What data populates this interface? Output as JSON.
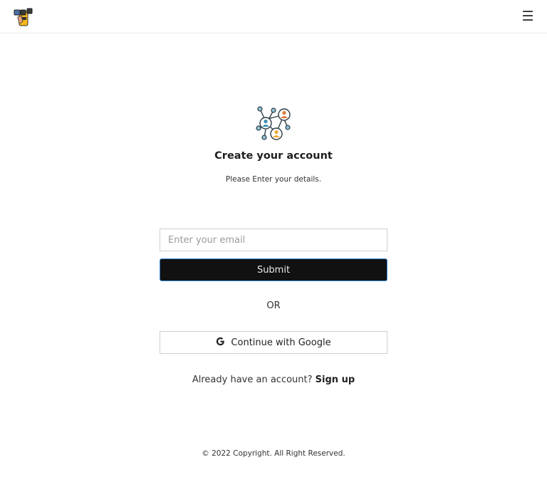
{
  "header": {
    "logo_icon": "app-logo-icon",
    "menu_icon": "hamburger-menu-icon",
    "menu_glyph": "☰"
  },
  "hero": {
    "icon": "network-people-icon",
    "title": "Create your account",
    "subtitle": "Please Enter your details."
  },
  "form": {
    "email_placeholder": "Enter your email",
    "email_value": "",
    "submit_label": "Submit"
  },
  "divider_text": "OR",
  "google": {
    "icon": "google-g-icon",
    "label": "Continue with Google"
  },
  "signup": {
    "prompt": "Already have an account?",
    "link_label": "Sign up"
  },
  "footer": {
    "copyright": "© 2022 Copyright. All Right Reserved."
  },
  "colors": {
    "submit_bg": "#111111",
    "submit_border": "#3a8fe0",
    "input_border": "#cfcfcf"
  }
}
